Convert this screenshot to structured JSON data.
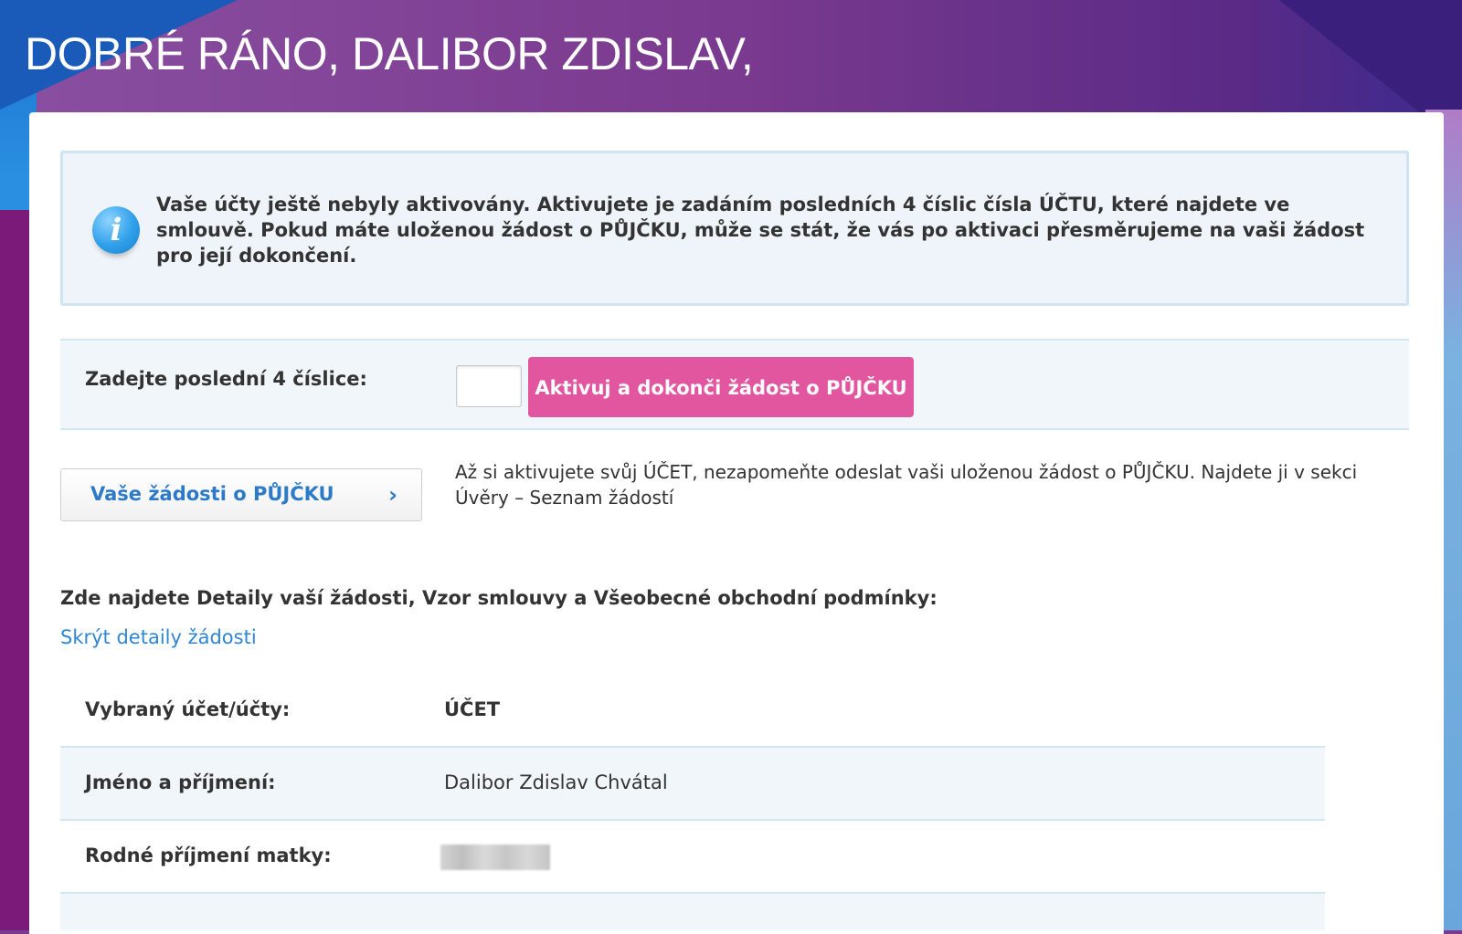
{
  "greeting": "DOBRÉ RÁNO, DALIBOR ZDISLAV,",
  "info": {
    "icon": "info-icon",
    "icon_glyph": "i",
    "text": "Vaše účty ještě nebyly aktivovány. Aktivujete je zadáním posledních 4 číslic čísla ÚČTU, které najdete ve smlouvě. Pokud máte uloženou žádost o PŮJČKU, může se stát, že vás po aktivaci přesměrujeme na vaši žádost pro její dokončení."
  },
  "activation": {
    "label": "Zadejte poslední 4 číslice:",
    "input_value": "",
    "button_label": "Aktivuj a dokonči žádost o PŮJČKU"
  },
  "loans": {
    "button_label": "Vaše žádosti o PŮJČKU",
    "chevron": "›",
    "note": "Až si aktivujete svůj ÚČET, nezapomeňte odeslat vaši uloženou žádost o PŮJČKU. Najdete ji v sekci Úvěry – Seznam žádostí"
  },
  "details": {
    "heading": "Zde najdete Detaily vaší žádosti, Vzor smlouvy a Všeobecné obchodní podmínky:",
    "toggle_link": "Skrýt detaily žádosti",
    "rows": [
      {
        "label": "Vybraný účet/účty:",
        "value": "ÚČET"
      },
      {
        "label": "Jméno a příjmení:",
        "value": "Dalibor Zdislav Chvátal"
      },
      {
        "label": "Rodné příjmení matky:",
        "value": ""
      }
    ]
  },
  "colors": {
    "accent_pink": "#e2559f",
    "link_blue": "#2f86d6",
    "info_bg": "#eef4f9"
  }
}
